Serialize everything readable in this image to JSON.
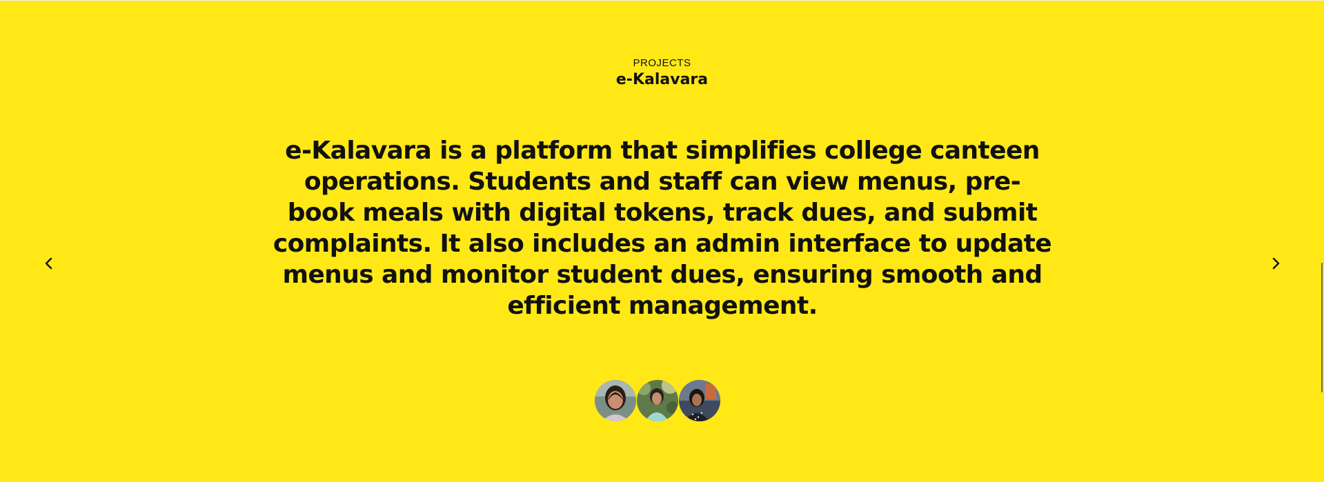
{
  "section": {
    "eyebrow": "PROJECTS",
    "title": "e-Kalavara",
    "description": "e-Kalavara is a platform that simplifies college canteen operations. Students and staff can view menus, pre-book meals with digital tokens, track dues, and submit complaints. It also includes an admin interface to update menus and monitor student dues, ensuring smooth and efficient management."
  },
  "navigation": {
    "prev_icon": "chevron-left-icon",
    "next_icon": "chevron-right-icon"
  },
  "team": {
    "avatar_count": 3
  },
  "colors": {
    "background": "#ffe816",
    "text": "#111111"
  }
}
